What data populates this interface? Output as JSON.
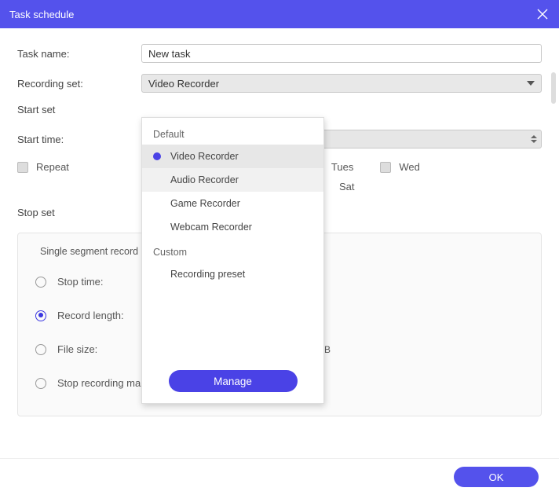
{
  "title": "Task schedule",
  "fields": {
    "task_name_label": "Task name:",
    "task_name_value": "New task",
    "recording_set_label": "Recording set:",
    "recording_set_value": "Video Recorder",
    "start_set_label": "Start set",
    "start_time_label": "Start time:",
    "repeat_label": "Repeat",
    "stop_set_label": "Stop set"
  },
  "days": {
    "tues": "Tues",
    "wed": "Wed",
    "sat": "Sat"
  },
  "panel": {
    "title": "Single segment record",
    "stop_time": "Stop time:",
    "record_length": "Record length:",
    "file_size": "File size:",
    "file_size_unit": "MB",
    "stop_manual": "Stop recording manually"
  },
  "dropdown": {
    "group_default": "Default",
    "opt_video": "Video Recorder",
    "opt_audio": "Audio Recorder",
    "opt_game": "Game Recorder",
    "opt_webcam": "Webcam Recorder",
    "group_custom": "Custom",
    "opt_preset": "Recording preset",
    "manage": "Manage"
  },
  "footer": {
    "ok": "OK"
  }
}
